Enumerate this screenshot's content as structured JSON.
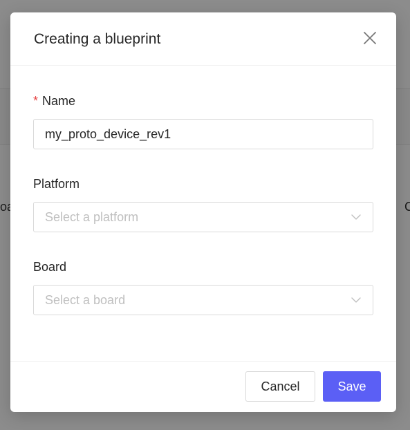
{
  "background": {
    "left_fragment": "oa",
    "right_fragment": "C"
  },
  "modal": {
    "title": "Creating a blueprint",
    "close_icon": "close-icon",
    "fields": {
      "name": {
        "required_mark": "*",
        "label": "Name",
        "value": "my_proto_device_rev1"
      },
      "platform": {
        "label": "Platform",
        "placeholder": "Select a platform"
      },
      "board": {
        "label": "Board",
        "placeholder": "Select a board"
      }
    },
    "footer": {
      "cancel_label": "Cancel",
      "save_label": "Save"
    }
  },
  "colors": {
    "primary": "#5b5ff5",
    "required": "#e64545",
    "placeholder": "#bfbfbf",
    "border": "#d9d9d9"
  }
}
